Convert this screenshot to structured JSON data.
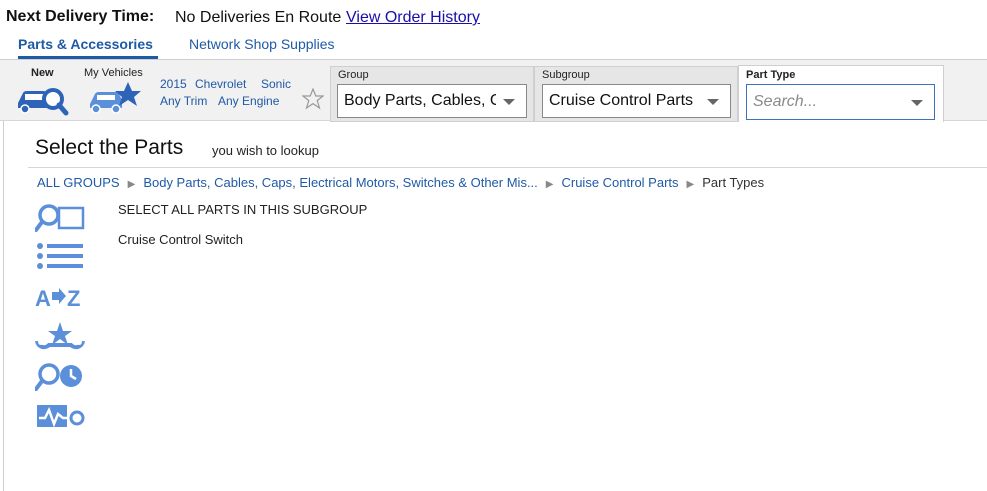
{
  "header": {
    "delivery_label": "Next Delivery Time:",
    "delivery_value": "No Deliveries En Route",
    "order_history_link": "View Order History"
  },
  "tabs": [
    {
      "label": "Parts & Accessories",
      "active": true
    },
    {
      "label": "Network Shop Supplies",
      "active": false
    }
  ],
  "toolbar": {
    "new_label": "New",
    "my_vehicles_label": "My Vehicles",
    "vehicle": {
      "year": "2015",
      "make": "Chevrolet",
      "model": "Sonic",
      "trim": "Any Trim",
      "engine": "Any Engine"
    },
    "group": {
      "label": "Group",
      "value": "Body Parts, Cables, Caps, Electrical Motors, Switches & Other Mis..."
    },
    "subgroup": {
      "label": "Subgroup",
      "value": "Cruise Control Parts"
    },
    "part_type": {
      "label": "Part Type",
      "placeholder": "Search..."
    }
  },
  "main": {
    "title": "Select the Parts",
    "subtitle": "you wish to lookup",
    "breadcrumbs": [
      "ALL GROUPS",
      "Body Parts, Cables, Caps, Electrical Motors, Switches & Other Mis...",
      "Cruise Control Parts",
      "Part Types"
    ],
    "parts": [
      "SELECT ALL PARTS IN THIS SUBGROUP",
      "Cruise Control Switch"
    ]
  },
  "side_icons": [
    "part-lookup-icon",
    "list-view-icon",
    "a-to-z-icon",
    "popular-service-icon",
    "labor-time-icon",
    "diagnostics-icon"
  ],
  "colors": {
    "accent": "#1f5aa6",
    "icon": "#5b8fd9",
    "link": "#1a0dab"
  }
}
